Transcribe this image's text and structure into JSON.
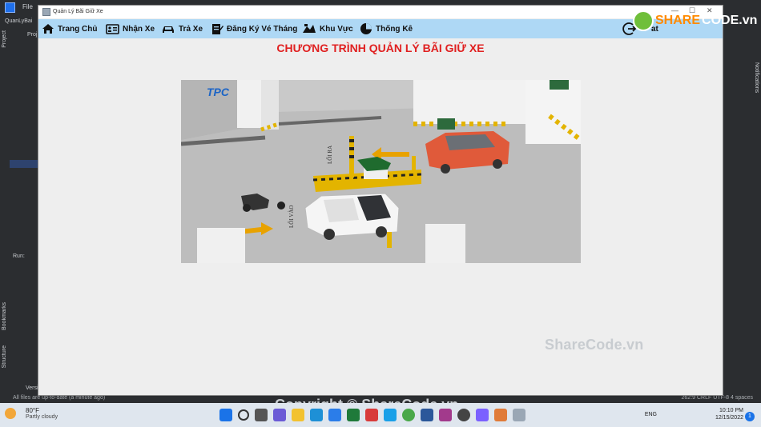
{
  "ide": {
    "menu_file": "File",
    "project_name": "QuanLyBai",
    "project_tab": "Proj",
    "tool_project": "Project",
    "tool_run": "Run:",
    "tool_bookmarks": "Bookmarks",
    "tool_structure": "Structure",
    "tool_versions": "Versi",
    "tool_notifications": "Notifications",
    "status_left": "All files are up-to-date (a minute ago)",
    "status_right": "262:9   CRLF   UTF-8   4 spaces"
  },
  "window": {
    "title": "Quản Lý Bãi Giữ Xe",
    "minimize": "—",
    "maximize": "☐",
    "close": "✕"
  },
  "menu": {
    "home": "Trang Chủ",
    "receive": "Nhận Xe",
    "return": "Trả Xe",
    "monthly": "Đăng Ký Vé Tháng",
    "area": "Khu Vực",
    "stats": "Thống Kê",
    "exit_partial": "at"
  },
  "main": {
    "title": "CHƯƠNG TRÌNH QUẢN LÝ BÃI GIỮ XE"
  },
  "scene": {
    "logo_text": "TPC",
    "sign_exit": "LỐI RA",
    "sign_enter": "LỐI VÀO"
  },
  "watermark": {
    "brand_s": "SHARE",
    "brand_c": "CODE.vn",
    "sharecode": "ShareCode.vn",
    "copyright": "Copyright © ShareCode.vn"
  },
  "taskbar": {
    "temp": "80°F",
    "weather": "Partly cloudy",
    "lang": "ENG",
    "time": "10:10 PM",
    "date": "12/15/2022",
    "notif_count": "1"
  },
  "colors": {
    "menubar": "#aed8f5",
    "title_red": "#e02020",
    "ide_dark": "#2b2d30"
  }
}
